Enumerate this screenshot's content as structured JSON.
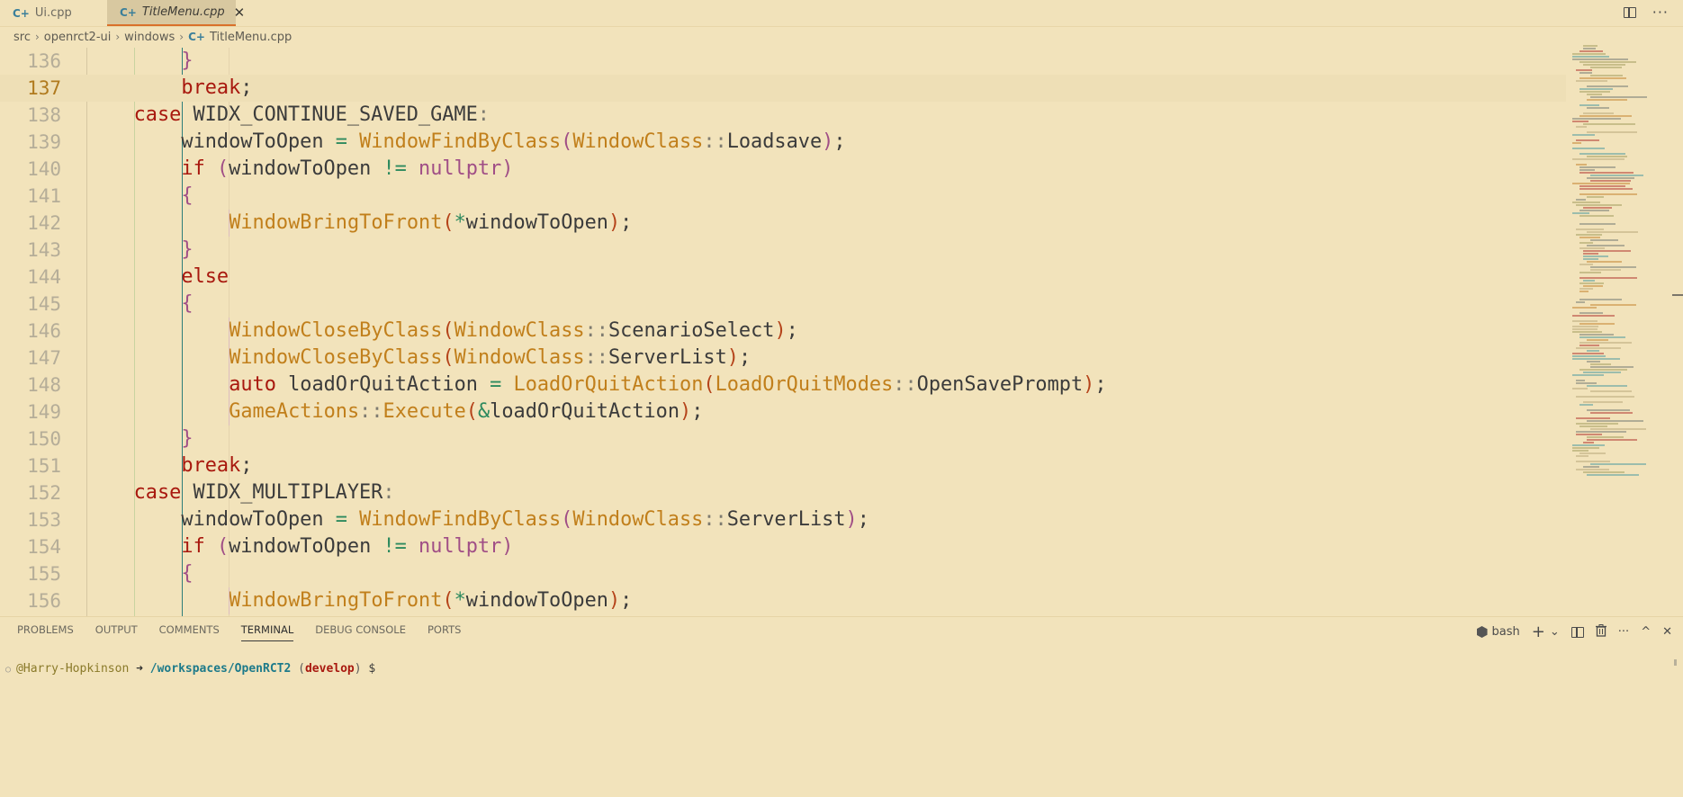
{
  "tabs": [
    {
      "label": "Ui.cpp",
      "icon": "cpp-file-icon",
      "active": false
    },
    {
      "label": "TitleMenu.cpp",
      "icon": "cpp-file-icon",
      "active": true,
      "close": "✕"
    }
  ],
  "tab_actions": {
    "split": "split-editor-icon",
    "more": "···"
  },
  "breadcrumb": [
    "src",
    "openrct2-ui",
    "windows",
    "TitleMenu.cpp"
  ],
  "breadcrumb_sep": "›",
  "editor": {
    "current_line": 137,
    "lines": [
      {
        "n": "136",
        "indent": 4,
        "tokens": [
          [
            "pn",
            "}"
          ]
        ]
      },
      {
        "n": "137",
        "indent": 4,
        "tokens": [
          [
            "kw",
            "break"
          ],
          [
            "tx",
            ";"
          ]
        ]
      },
      {
        "n": "138",
        "indent": 3,
        "tokens": [
          [
            "kw",
            "case"
          ],
          [
            "tx",
            " WIDX_CONTINUE_SAVED_GAME"
          ],
          [
            "cl",
            ":"
          ]
        ]
      },
      {
        "n": "139",
        "indent": 4,
        "tokens": [
          [
            "tx",
            "windowToOpen "
          ],
          [
            "op",
            "="
          ],
          [
            "tx",
            " "
          ],
          [
            "fn",
            "WindowFindByClass"
          ],
          [
            "pn",
            "("
          ],
          [
            "fn",
            "WindowClass"
          ],
          [
            "cl",
            "::"
          ],
          [
            "tx",
            "Loadsave"
          ],
          [
            "pn",
            ")"
          ],
          [
            "tx",
            ";"
          ]
        ]
      },
      {
        "n": "140",
        "indent": 4,
        "tokens": [
          [
            "kw",
            "if"
          ],
          [
            "tx",
            " "
          ],
          [
            "pn",
            "("
          ],
          [
            "tx",
            "windowToOpen "
          ],
          [
            "op",
            "!="
          ],
          [
            "tx",
            " "
          ],
          [
            "nu",
            "nullptr"
          ],
          [
            "pn",
            ")"
          ]
        ]
      },
      {
        "n": "141",
        "indent": 4,
        "tokens": [
          [
            "pn",
            "{"
          ]
        ]
      },
      {
        "n": "142",
        "indent": 5,
        "tokens": [
          [
            "fn",
            "WindowBringToFront"
          ],
          [
            "br",
            "("
          ],
          [
            "op",
            "*"
          ],
          [
            "tx",
            "windowToOpen"
          ],
          [
            "br",
            ")"
          ],
          [
            "tx",
            ";"
          ]
        ]
      },
      {
        "n": "143",
        "indent": 4,
        "tokens": [
          [
            "pn",
            "}"
          ]
        ]
      },
      {
        "n": "144",
        "indent": 4,
        "tokens": [
          [
            "kw",
            "else"
          ]
        ]
      },
      {
        "n": "145",
        "indent": 4,
        "tokens": [
          [
            "pn",
            "{"
          ]
        ]
      },
      {
        "n": "146",
        "indent": 5,
        "tokens": [
          [
            "fn",
            "WindowCloseByClass"
          ],
          [
            "br",
            "("
          ],
          [
            "fn",
            "WindowClass"
          ],
          [
            "cl",
            "::"
          ],
          [
            "tx",
            "ScenarioSelect"
          ],
          [
            "br",
            ")"
          ],
          [
            "tx",
            ";"
          ]
        ]
      },
      {
        "n": "147",
        "indent": 5,
        "tokens": [
          [
            "fn",
            "WindowCloseByClass"
          ],
          [
            "br",
            "("
          ],
          [
            "fn",
            "WindowClass"
          ],
          [
            "cl",
            "::"
          ],
          [
            "tx",
            "ServerList"
          ],
          [
            "br",
            ")"
          ],
          [
            "tx",
            ";"
          ]
        ]
      },
      {
        "n": "148",
        "indent": 5,
        "tokens": [
          [
            "kw",
            "auto"
          ],
          [
            "tx",
            " loadOrQuitAction "
          ],
          [
            "op",
            "="
          ],
          [
            "tx",
            " "
          ],
          [
            "fn",
            "LoadOrQuitAction"
          ],
          [
            "br",
            "("
          ],
          [
            "fn",
            "LoadOrQuitModes"
          ],
          [
            "cl",
            "::"
          ],
          [
            "tx",
            "OpenSavePrompt"
          ],
          [
            "br",
            ")"
          ],
          [
            "tx",
            ";"
          ]
        ]
      },
      {
        "n": "149",
        "indent": 5,
        "tokens": [
          [
            "fn",
            "GameActions"
          ],
          [
            "cl",
            "::"
          ],
          [
            "fn",
            "Execute"
          ],
          [
            "br",
            "("
          ],
          [
            "op",
            "&"
          ],
          [
            "tx",
            "loadOrQuitAction"
          ],
          [
            "br",
            ")"
          ],
          [
            "tx",
            ";"
          ]
        ]
      },
      {
        "n": "150",
        "indent": 4,
        "tokens": [
          [
            "pn",
            "}"
          ]
        ]
      },
      {
        "n": "151",
        "indent": 4,
        "tokens": [
          [
            "kw",
            "break"
          ],
          [
            "tx",
            ";"
          ]
        ]
      },
      {
        "n": "152",
        "indent": 3,
        "tokens": [
          [
            "kw",
            "case"
          ],
          [
            "tx",
            " WIDX_MULTIPLAYER"
          ],
          [
            "cl",
            ":"
          ]
        ]
      },
      {
        "n": "153",
        "indent": 4,
        "tokens": [
          [
            "tx",
            "windowToOpen "
          ],
          [
            "op",
            "="
          ],
          [
            "tx",
            " "
          ],
          [
            "fn",
            "WindowFindByClass"
          ],
          [
            "pn",
            "("
          ],
          [
            "fn",
            "WindowClass"
          ],
          [
            "cl",
            "::"
          ],
          [
            "tx",
            "ServerList"
          ],
          [
            "pn",
            ")"
          ],
          [
            "tx",
            ";"
          ]
        ]
      },
      {
        "n": "154",
        "indent": 4,
        "tokens": [
          [
            "kw",
            "if"
          ],
          [
            "tx",
            " "
          ],
          [
            "pn",
            "("
          ],
          [
            "tx",
            "windowToOpen "
          ],
          [
            "op",
            "!="
          ],
          [
            "tx",
            " "
          ],
          [
            "nu",
            "nullptr"
          ],
          [
            "pn",
            ")"
          ]
        ]
      },
      {
        "n": "155",
        "indent": 4,
        "tokens": [
          [
            "pn",
            "{"
          ]
        ]
      },
      {
        "n": "156",
        "indent": 5,
        "tokens": [
          [
            "fn",
            "WindowBringToFront"
          ],
          [
            "br",
            "("
          ],
          [
            "op",
            "*"
          ],
          [
            "tx",
            "windowToOpen"
          ],
          [
            "br",
            ")"
          ],
          [
            "tx",
            ";"
          ]
        ]
      }
    ]
  },
  "panel": {
    "tabs": [
      "PROBLEMS",
      "OUTPUT",
      "COMMENTS",
      "TERMINAL",
      "DEBUG CONSOLE",
      "PORTS"
    ],
    "active_tab": "TERMINAL",
    "shell": "bash",
    "actions": {
      "new_terminal": "+",
      "dropdown": "⌄",
      "split": "split-terminal-icon",
      "kill": "trash-icon",
      "more": "···",
      "maximize": "^",
      "close": "✕"
    }
  },
  "terminal": {
    "user": "@Harry-Hopkinson",
    "arrow": "➜",
    "path": "/workspaces/OpenRCT2",
    "branch": "develop",
    "prompt": "$"
  },
  "colors": {
    "background": "#f2e3bb",
    "keyword": "#a8180e",
    "function": "#c17f1b",
    "active_tab_border": "#d9702a",
    "terminal_path": "#1d7a8a"
  }
}
